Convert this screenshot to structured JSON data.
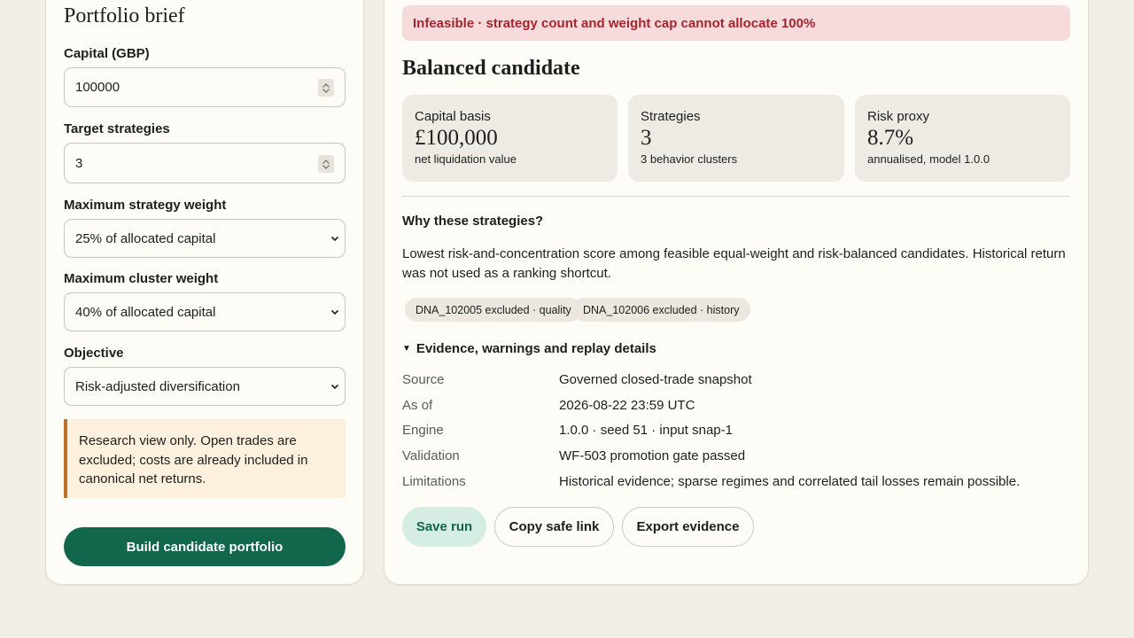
{
  "brief": {
    "title": "Portfolio brief",
    "capital_label": "Capital (GBP)",
    "capital_value": "100000",
    "strategies_label": "Target strategies",
    "strategies_value": "3",
    "max_strategy_label": "Maximum strategy weight",
    "max_strategy_value": "25% of allocated capital",
    "max_cluster_label": "Maximum cluster weight",
    "max_cluster_value": "40% of allocated capital",
    "objective_label": "Objective",
    "objective_value": "Risk-adjusted diversification",
    "notice": "Research view only. Open trades are excluded; costs are already included in canonical net returns.",
    "build_button": "Build candidate portfolio"
  },
  "result": {
    "alert": "Infeasible · strategy count and weight cap cannot allocate 100%",
    "title": "Balanced candidate",
    "metrics": [
      {
        "label": "Capital basis",
        "value": "£100,000",
        "sub": "net liquidation value"
      },
      {
        "label": "Strategies",
        "value": "3",
        "sub": "3 behavior clusters"
      },
      {
        "label": "Risk proxy",
        "value": "8.7%",
        "sub": "annualised, model 1.0.0"
      }
    ],
    "why_title": "Why these strategies?",
    "why_text": "Lowest risk-and-concentration score among feasible equal-weight and risk-balanced candidates. Historical return was not used as a ranking shortcut.",
    "chips": [
      "DNA_102005 excluded · quality",
      "DNA_102006 excluded · history"
    ],
    "details_summary": "Evidence, warnings and replay details",
    "details": [
      {
        "key": "Source",
        "value": "Governed closed-trade snapshot"
      },
      {
        "key": "As of",
        "value": "2026-08-22 23:59 UTC"
      },
      {
        "key": "Engine",
        "value": "1.0.0 · seed 51 · input snap-1"
      },
      {
        "key": "Validation",
        "value": "WF-503 promotion gate passed"
      },
      {
        "key": "Limitations",
        "value": "Historical evidence; sparse regimes and correlated tail losses remain possible."
      }
    ],
    "save_button": "Save run",
    "copy_button": "Copy safe link",
    "export_button": "Export evidence"
  },
  "colors": {
    "accent": "#11664c",
    "alert_bg": "#f6dadc",
    "alert_text": "#a3262f",
    "notice_border": "#c0702c"
  }
}
